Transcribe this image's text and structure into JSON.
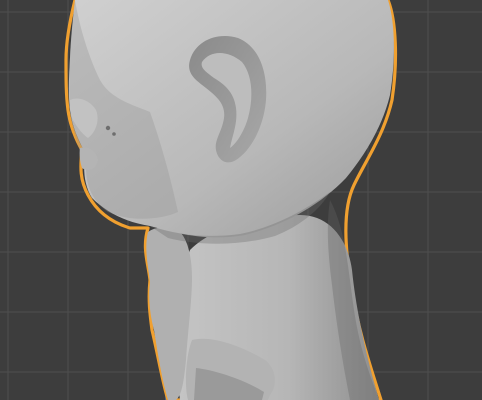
{
  "viewport": {
    "background_color": "#3d3d3d",
    "grid_line_color": "#4e4e4e",
    "axis_line_color": "#4a6fa3",
    "selection_outline_color": "#f0a030",
    "mesh_color": "#b9b9b9",
    "mesh_shadow_color": "#8c8c8c",
    "mesh_highlight_color": "#d4d4d4"
  },
  "selected_object": {
    "selected": true,
    "outline_icon": "selection-outline",
    "shading": "solid"
  }
}
